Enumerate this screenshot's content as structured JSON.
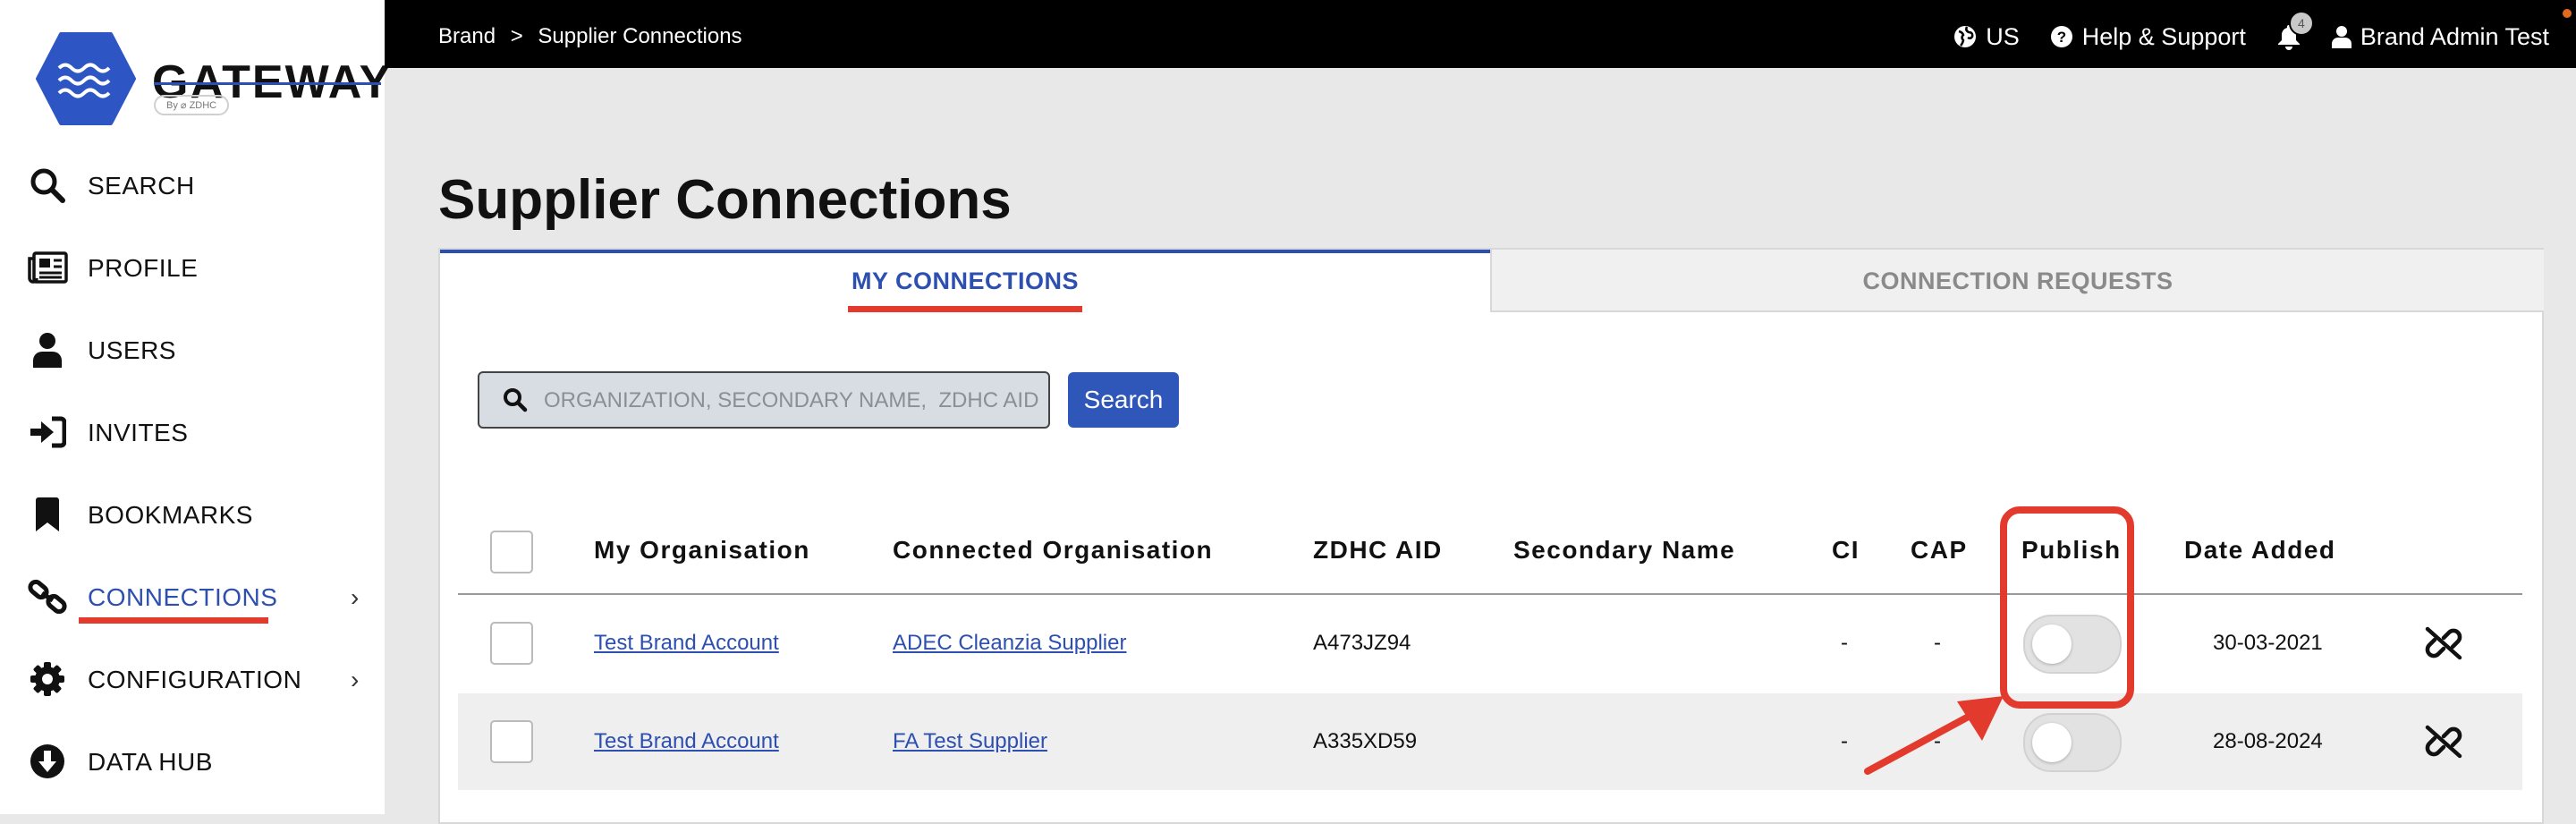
{
  "brand": {
    "logo_text": "GATEWAY",
    "logo_sub": "By ⌀ ZDHC"
  },
  "sidebar": {
    "items": [
      {
        "label": "SEARCH",
        "icon": "search-icon"
      },
      {
        "label": "PROFILE",
        "icon": "newspaper-icon"
      },
      {
        "label": "USERS",
        "icon": "user-icon"
      },
      {
        "label": "INVITES",
        "icon": "sign-in-icon"
      },
      {
        "label": "BOOKMARKS",
        "icon": "bookmark-icon"
      },
      {
        "label": "CONNECTIONS",
        "icon": "link-icon",
        "active": true,
        "has_submenu": true
      },
      {
        "label": "CONFIGURATION",
        "icon": "gear-icon",
        "has_submenu": true
      },
      {
        "label": "DATA HUB",
        "icon": "download-circle-icon"
      }
    ]
  },
  "topbar": {
    "breadcrumb": [
      "Brand",
      "Supplier Connections"
    ],
    "breadcrumb_sep": ">",
    "language": "US",
    "help": "Help & Support",
    "notification_badge": "4",
    "user": "Brand Admin Test"
  },
  "page": {
    "title": "Supplier Connections"
  },
  "tabs": {
    "my": "MY CONNECTIONS",
    "requests": "CONNECTION REQUESTS"
  },
  "search": {
    "placeholder": "ORGANIZATION, SECONDARY NAME,  ZDHC AID",
    "button": "Search"
  },
  "table": {
    "columns": [
      "My Organisation",
      "Connected Organisation",
      "ZDHC AID",
      "Secondary Name",
      "CI",
      "CAP",
      "Publish",
      "Date Added"
    ],
    "rows": [
      {
        "my_org": "Test Brand Account",
        "connected_org": "ADEC Cleanzia Supplier",
        "zdhc_aid": "A473JZ94",
        "secondary_name": "",
        "ci": "-",
        "cap": "-",
        "publish": false,
        "date_added": "30-03-2021"
      },
      {
        "my_org": "Test Brand Account",
        "connected_org": "FA Test Supplier",
        "zdhc_aid": "A335XD59",
        "secondary_name": "",
        "ci": "-",
        "cap": "-",
        "publish": false,
        "date_added": "28-08-2024"
      }
    ]
  },
  "colors": {
    "accent": "#2d4fb0",
    "annotation": "#e23b2e",
    "topbar": "#000000"
  }
}
